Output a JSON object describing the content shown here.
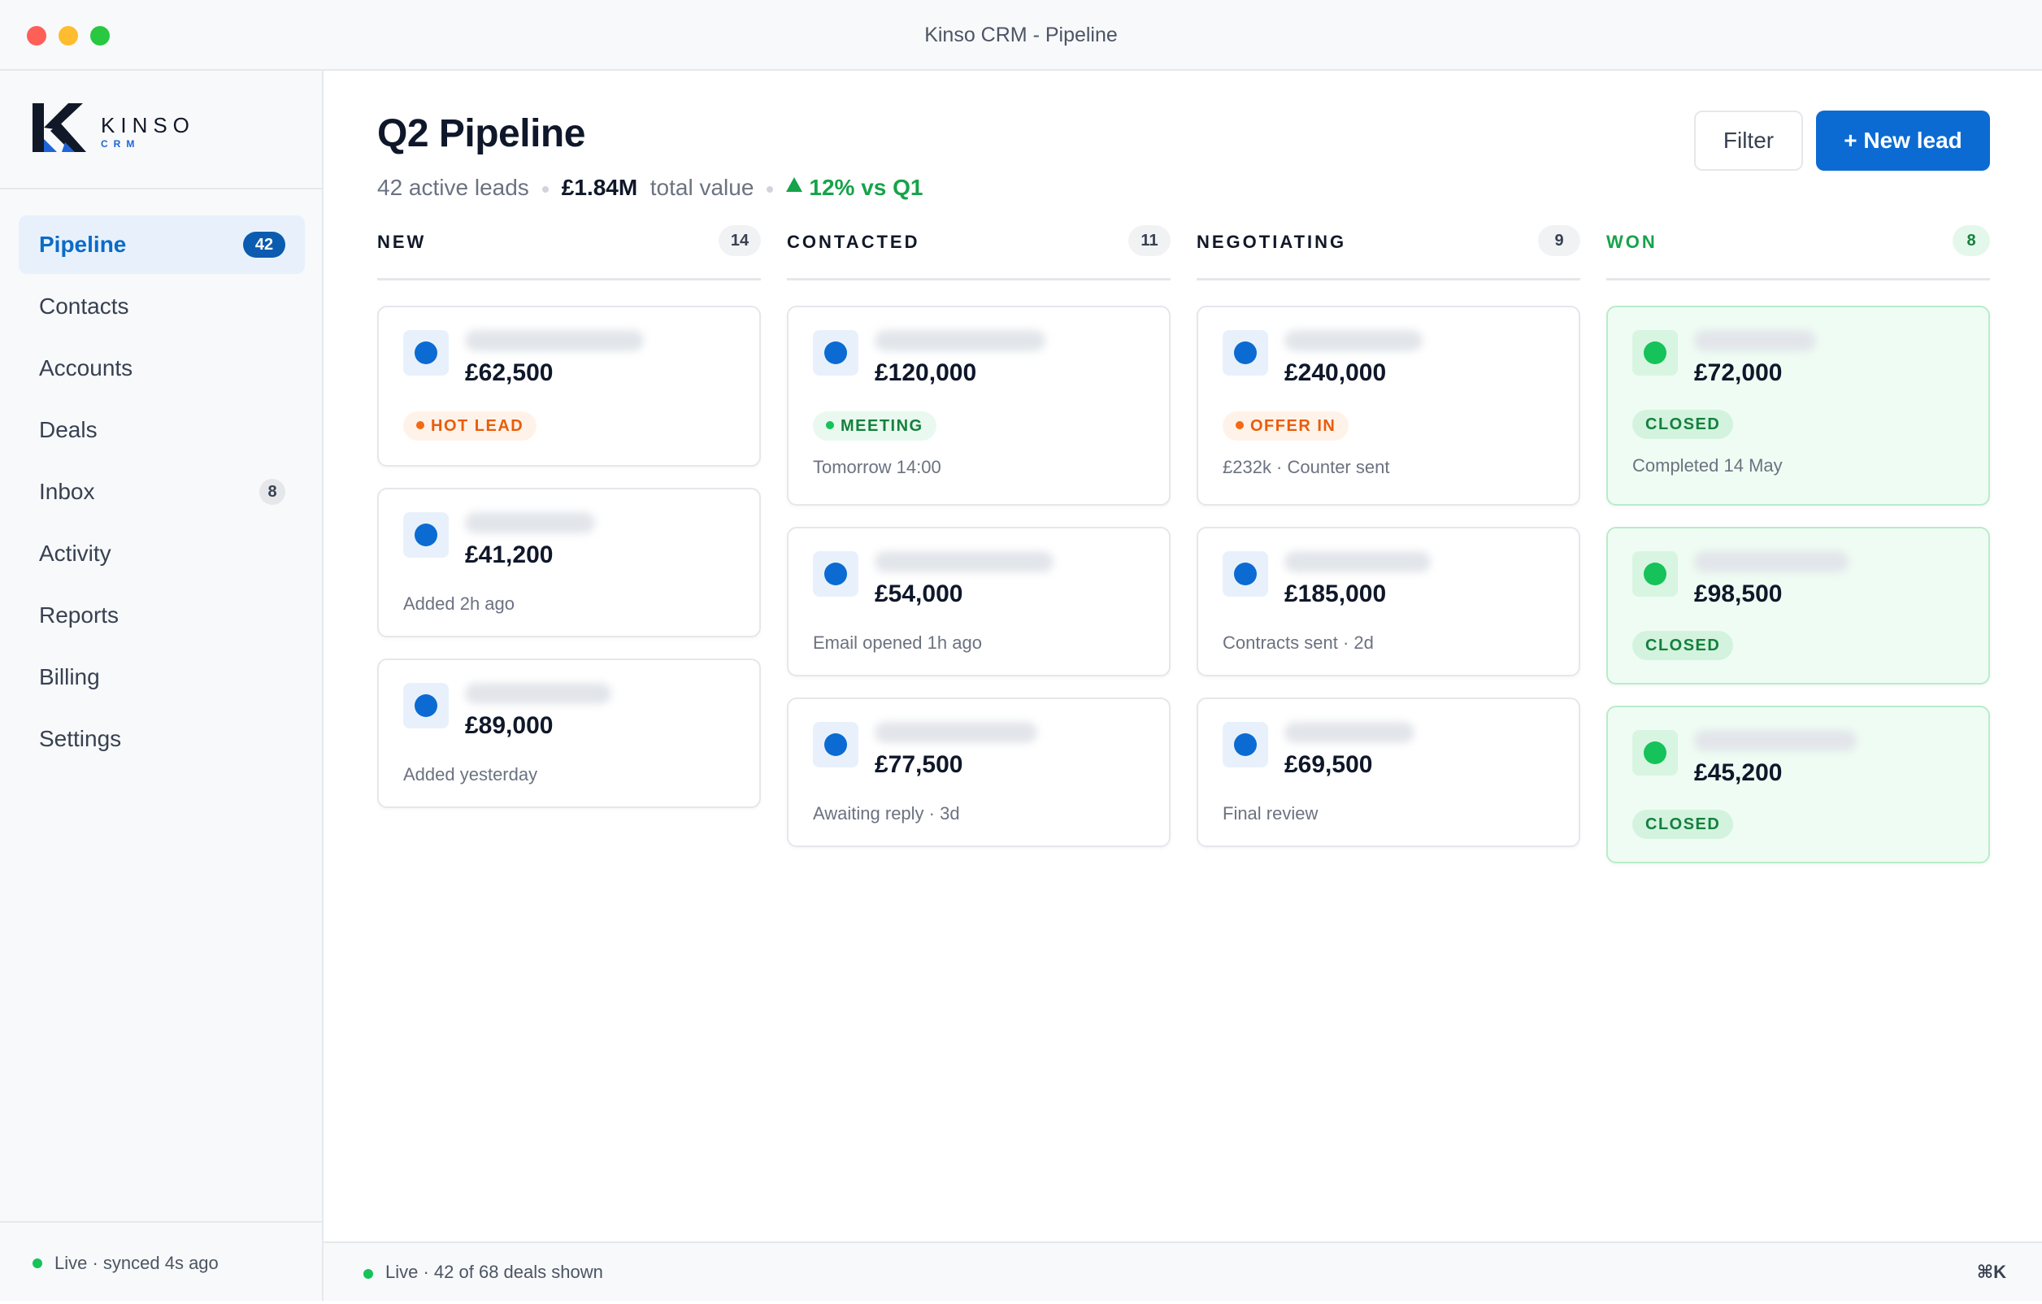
{
  "window": {
    "title": "Kinso CRM - Pipeline"
  },
  "brand": {
    "name": "KINSO",
    "sub": "CRM"
  },
  "sidebar": {
    "items": [
      {
        "label": "Pipeline",
        "badge": "42",
        "active": true
      },
      {
        "label": "Contacts",
        "badge": ""
      },
      {
        "label": "Accounts",
        "badge": ""
      },
      {
        "label": "Deals",
        "badge": ""
      },
      {
        "label": "Inbox",
        "badge": "8"
      },
      {
        "label": "Activity",
        "badge": ""
      },
      {
        "label": "Reports",
        "badge": ""
      },
      {
        "label": "Billing",
        "badge": ""
      },
      {
        "label": "Settings",
        "badge": ""
      }
    ],
    "footer": "Live · synced 4s ago"
  },
  "header": {
    "title": "Q2 Pipeline",
    "active_leads": "42 active leads",
    "total_value": "£1.84M",
    "total_value_label": "total value",
    "growth": "12% vs Q1",
    "filter_label": "Filter",
    "new_lead_label": "+ New lead"
  },
  "columns": [
    {
      "title": "NEW",
      "count": "14",
      "cards": [
        {
          "amount": "£62,500",
          "tag": "HOT LEAD",
          "meta": ""
        },
        {
          "amount": "£41,200",
          "tag": "",
          "meta": "Added 2h ago"
        },
        {
          "amount": "£89,000",
          "tag": "",
          "meta": "Added yesterday"
        }
      ]
    },
    {
      "title": "CONTACTED",
      "count": "11",
      "cards": [
        {
          "amount": "£120,000",
          "tag": "MEETING",
          "meta": "Tomorrow 14:00"
        },
        {
          "amount": "£54,000",
          "tag": "",
          "meta": "Email opened 1h ago"
        },
        {
          "amount": "£77,500",
          "tag": "",
          "meta": "Awaiting reply · 3d"
        }
      ]
    },
    {
      "title": "NEGOTIATING",
      "count": "9",
      "cards": [
        {
          "amount": "£240,000",
          "tag": "OFFER IN",
          "meta": "£232k · Counter sent"
        },
        {
          "amount": "£185,000",
          "tag": "",
          "meta": "Contracts sent · 2d"
        },
        {
          "amount": "£69,500",
          "tag": "",
          "meta": "Final review"
        }
      ]
    },
    {
      "title": "WON",
      "count": "8",
      "cards": [
        {
          "amount": "£72,000",
          "tag": "CLOSED",
          "meta": "Completed 14 May"
        },
        {
          "amount": "£98,500",
          "tag": "CLOSED",
          "meta": ""
        },
        {
          "amount": "£45,200",
          "tag": "CLOSED",
          "meta": ""
        }
      ]
    }
  ],
  "statusbar": {
    "text": "Live · 42 of 68 deals shown",
    "shortcut": "⌘K"
  },
  "colors": {
    "accent": "#0b6bd2",
    "success": "#16c25a",
    "warning": "#f26a12"
  }
}
